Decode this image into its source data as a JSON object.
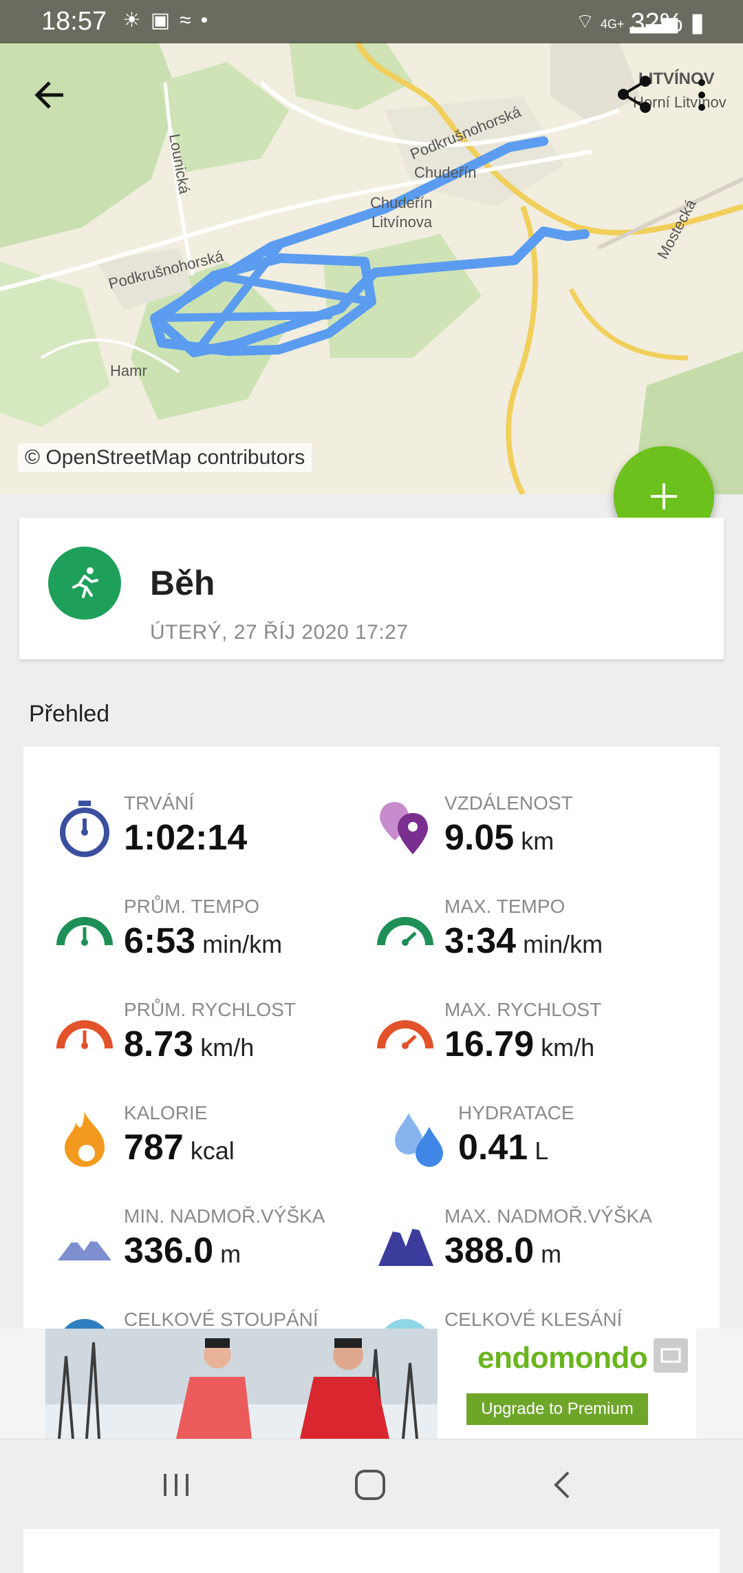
{
  "status_bar": {
    "time": "18:57",
    "network": "4G+",
    "battery": "32%"
  },
  "map": {
    "attribution": "© OpenStreetMap contributors",
    "labels": [
      "Podkrušnohorská",
      "Chudeřín",
      "Chudeřín",
      "Litvínova",
      "Podkrušnohorská",
      "Lounická",
      "Hamr",
      "LITVÍNOV",
      "Horní Litvínov",
      "Mostecká"
    ]
  },
  "workout": {
    "sport": "Běh",
    "datetime": "ÚTERÝ, 27 ŘÍJ 2020 17:27"
  },
  "overview": {
    "title": "Přehled",
    "stats": [
      {
        "label": "TRVÁNÍ",
        "value": "1:02:14",
        "unit": "",
        "icon": "stopwatch-icon"
      },
      {
        "label": "VZDÁLENOST",
        "value": "9.05",
        "unit": "km",
        "icon": "distance-pins-icon"
      },
      {
        "label": "PRŮM. TEMPO",
        "value": "6:53",
        "unit": "min/km",
        "icon": "avg-pace-gauge-icon"
      },
      {
        "label": "MAX. TEMPO",
        "value": "3:34",
        "unit": "min/km",
        "icon": "max-pace-gauge-icon"
      },
      {
        "label": "PRŮM. RYCHLOST",
        "value": "8.73",
        "unit": "km/h",
        "icon": "avg-speed-gauge-icon"
      },
      {
        "label": "MAX. RYCHLOST",
        "value": "16.79",
        "unit": "km/h",
        "icon": "max-speed-gauge-icon"
      },
      {
        "label": "KALORIE",
        "value": "787",
        "unit": "kcal",
        "icon": "flame-icon"
      },
      {
        "label": "HYDRATACE",
        "value": "0.41",
        "unit": "L",
        "icon": "water-drops-icon"
      },
      {
        "label": "MIN. NADMOŘ.VÝŠKA",
        "value": "336.0",
        "unit": "m",
        "icon": "mountain-low-icon"
      },
      {
        "label": "MAX. NADMOŘ.VÝŠKA",
        "value": "388.0",
        "unit": "m",
        "icon": "mountain-high-icon"
      },
      {
        "label": "CELKOVÉ STOUPÁNÍ",
        "value": "",
        "unit": "",
        "icon": "ascent-icon"
      },
      {
        "label": "CELKOVÉ KLESÁNÍ",
        "value": "",
        "unit": "",
        "icon": "descent-icon"
      }
    ]
  },
  "ad": {
    "brand": "endomondo",
    "cta": "Upgrade to Premium"
  },
  "colors": {
    "accent_green": "#6cc11c",
    "route": "#5b9cf0",
    "sport_badge": "#1ea05a"
  }
}
